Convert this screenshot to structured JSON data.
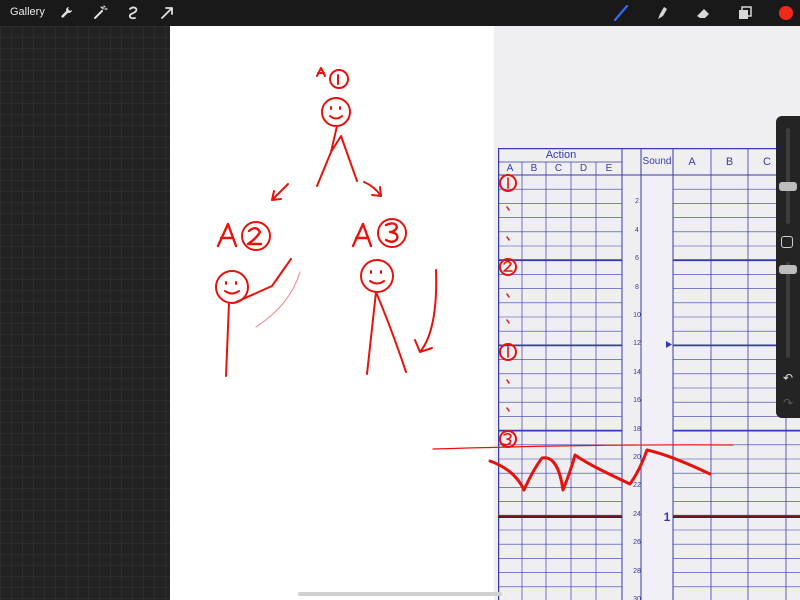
{
  "toolbar": {
    "gallery_label": "Gallery",
    "left_icons": [
      "wrench-icon",
      "magic-wand-icon",
      "selection-icon",
      "transform-arrow-icon"
    ],
    "right_icons": [
      "brush-icon",
      "smudge-icon",
      "eraser-icon",
      "layers-icon",
      "color-icon"
    ],
    "brush_color": "#2e6cf0",
    "active_color": "#f0291d"
  },
  "drawing": {
    "ink_color": "#e8120c",
    "labels": [
      "A",
      "A",
      "A"
    ]
  },
  "exposure_sheet": {
    "color": "#3a3ab0",
    "action_label": "Action",
    "action_columns": [
      "A",
      "B",
      "C",
      "D",
      "E"
    ],
    "sound_label": "Sound",
    "cel_columns": [
      "A",
      "B",
      "C"
    ],
    "frame_numbers": [
      "2",
      "4",
      "6",
      "8",
      "10",
      "12",
      "14",
      "16",
      "18",
      "20",
      "22",
      "24",
      "26",
      "28",
      "30"
    ],
    "marker_label": "1",
    "marker_line_color": "#7a0f0f"
  },
  "side_panel": {
    "undo_icon": "undo-icon",
    "redo_icon": "redo-icon"
  }
}
